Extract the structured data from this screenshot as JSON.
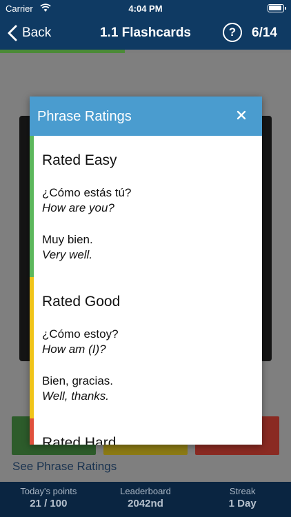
{
  "status": {
    "carrier": "Carrier",
    "time": "4:04 PM"
  },
  "nav": {
    "back_label": "Back",
    "title": "1.1 Flashcards",
    "help_label": "?",
    "counter": "6/14"
  },
  "progress": {
    "fraction": 0.43
  },
  "links": {
    "see_ratings": "See Phrase Ratings"
  },
  "footer": {
    "points_label": "Today's points",
    "points_value": "21 / 100",
    "leaderboard_label": "Leaderboard",
    "leaderboard_value": "2042nd",
    "streak_label": "Streak",
    "streak_value": "1 Day"
  },
  "modal": {
    "title": "Phrase Ratings",
    "sections": [
      {
        "title": "Rated Easy",
        "color": "#5cb85c",
        "phrases": [
          {
            "text": "¿Cómo estás tú?",
            "translation": "How are you?"
          },
          {
            "text": "Muy bien.",
            "translation": "Very well."
          }
        ]
      },
      {
        "title": "Rated Good",
        "color": "#f0c419",
        "phrases": [
          {
            "text": "¿Cómo estoy?",
            "translation": "How am (I)?"
          },
          {
            "text": "Bien, gracias.",
            "translation": "Well, thanks."
          }
        ]
      },
      {
        "title": "Rated Hard",
        "color": "#e0503c",
        "phrases": []
      }
    ]
  },
  "colors": {
    "nav_bg": "#0f3a63",
    "modal_header": "#4a9ccf",
    "footer_bg": "#0a2541"
  }
}
